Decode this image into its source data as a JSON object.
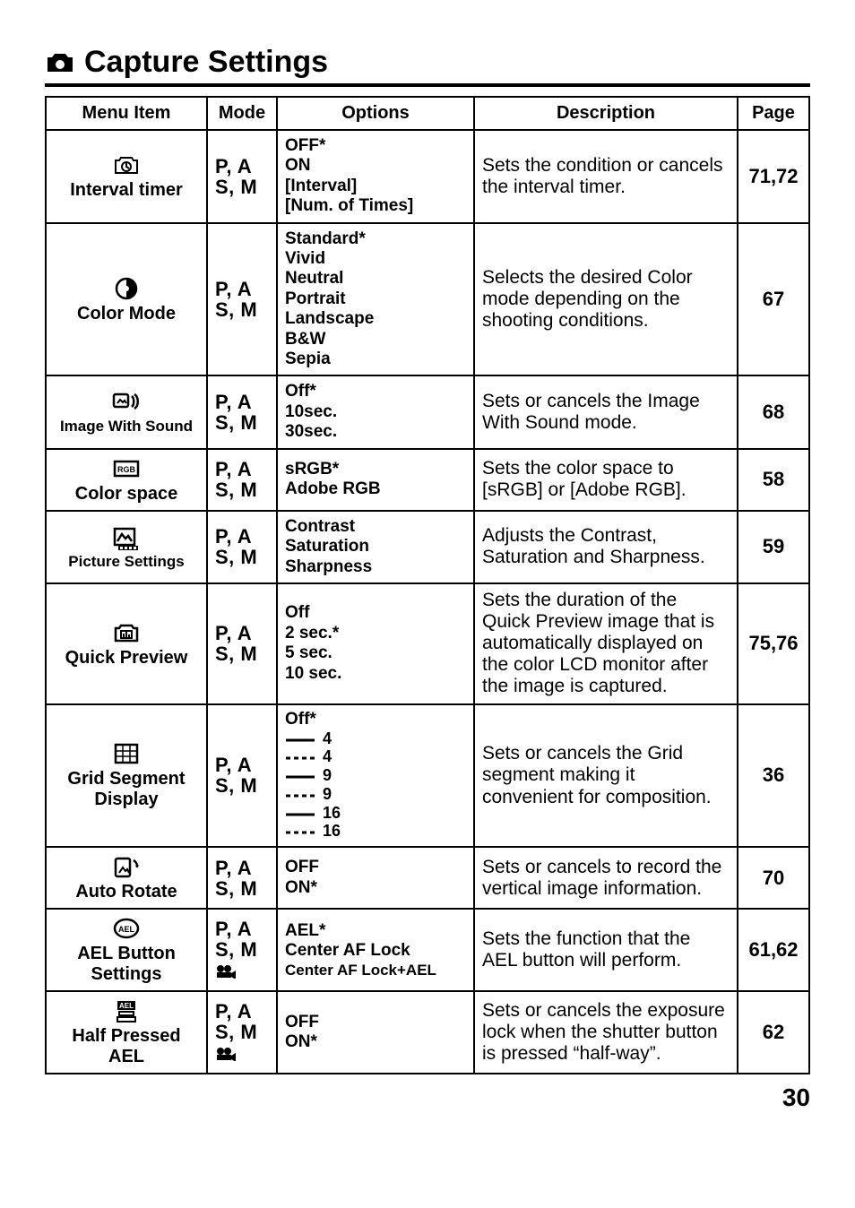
{
  "title": "Capture Settings",
  "footer_page": "30",
  "headers": {
    "menu": "Menu Item",
    "mode": "Mode",
    "options": "Options",
    "description": "Description",
    "page": "Page"
  },
  "modes": {
    "pasm": "P, A\nS, M",
    "pasm_movie": "P, A\nS, M"
  },
  "rows": [
    {
      "label": "Interval timer",
      "icon": "interval-timer-icon",
      "mode": "pasm",
      "options": "OFF*\nON\n[Interval]\n[Num. of Times]",
      "desc": "Sets the condition or cancels the interval timer.",
      "page": "71,72"
    },
    {
      "label": "Color Mode",
      "icon": "color-mode-icon",
      "mode": "pasm",
      "options": "Standard*\nVivid\nNeutral\nPortrait\nLandscape\nB&W\nSepia",
      "desc": "Selects the desired Color mode depending on the shooting conditions.",
      "page": "67"
    },
    {
      "label": "Image With Sound",
      "icon": "image-with-sound-icon",
      "mode": "pasm",
      "small": true,
      "options": "Off*\n10sec.\n30sec.",
      "desc": "Sets or cancels the Image With Sound mode.",
      "page": "68"
    },
    {
      "label": "Color space",
      "icon": "color-space-icon",
      "mode": "pasm",
      "options": "sRGB*\nAdobe RGB",
      "desc": "Sets the color space to [sRGB] or [Adobe RGB].",
      "page": "58"
    },
    {
      "label": "Picture Settings",
      "icon": "picture-settings-icon",
      "mode": "pasm",
      "small": true,
      "options": "Contrast\nSaturation\nSharpness",
      "desc": "Adjusts the Contrast, Saturation and Sharpness.",
      "page": "59"
    },
    {
      "label": "Quick Preview",
      "icon": "quick-preview-icon",
      "mode": "pasm",
      "options": "Off\n2 sec.*\n5 sec.\n10 sec.",
      "desc": "Sets the duration of the Quick Preview image that is automatically displayed on the color LCD monitor after the image is captured.",
      "page": "75,76"
    },
    {
      "label": "Grid Segment Display",
      "icon": "grid-segment-icon",
      "mode": "pasm",
      "grid_options": {
        "off": "Off*",
        "lines": [
          {
            "style": "solid",
            "n": "4"
          },
          {
            "style": "dashed",
            "n": "4"
          },
          {
            "style": "solid",
            "n": "9"
          },
          {
            "style": "dashed",
            "n": "9"
          },
          {
            "style": "solid",
            "n": "16"
          },
          {
            "style": "dashed",
            "n": "16"
          }
        ]
      },
      "desc": "Sets or cancels the Grid segment making it convenient for composition.",
      "page": "36"
    },
    {
      "label": "Auto Rotate",
      "icon": "auto-rotate-icon",
      "mode": "pasm",
      "options": "OFF\nON*",
      "desc": "Sets or cancels to record the vertical image information.",
      "page": "70"
    },
    {
      "label": "AEL Button Settings",
      "icon": "ael-button-icon",
      "mode": "pasm_movie",
      "options": "AEL*\nCenter AF Lock",
      "options_extra": "Center AF Lock+AEL",
      "desc": "Sets the function that the AEL button will perform.",
      "page": "61,62"
    },
    {
      "label": "Half Pressed AEL",
      "icon": "half-pressed-ael-icon",
      "mode": "pasm_movie",
      "options": "OFF\nON*",
      "desc": "Sets or cancels the exposure lock when the shutter button is pressed “half-way”.",
      "page": "62"
    }
  ]
}
